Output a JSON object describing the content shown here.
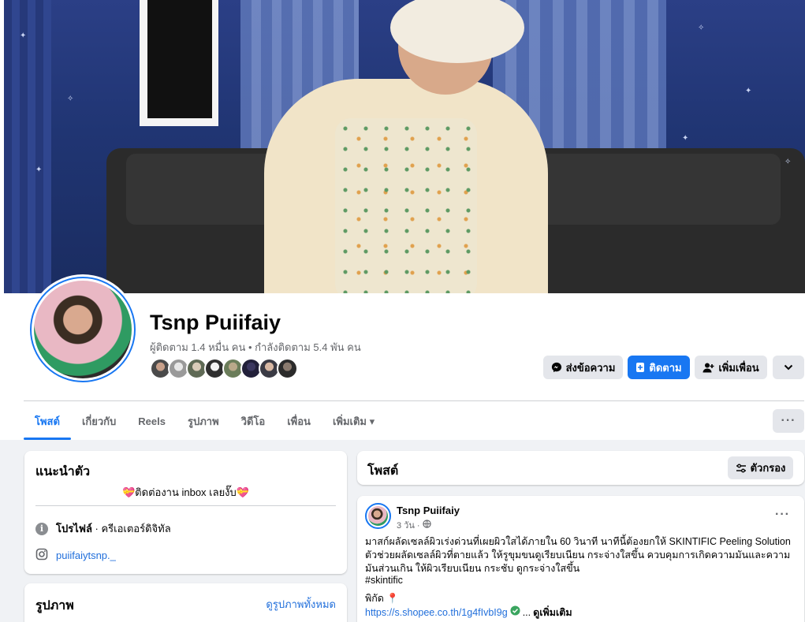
{
  "colors": {
    "accent": "#1877f2",
    "link": "#216fdb",
    "muted": "#65676b",
    "bg": "#f0f2f5"
  },
  "profile": {
    "name": "Tsnp Puiifaiy",
    "followers_line": "ผู้ติดตาม 1.4 หมื่น คน • กำลังติดตาม 5.4 พัน คน",
    "friend_avatars_count": 8
  },
  "actions": {
    "message": {
      "label": "ส่งข้อความ",
      "icon": "messenger-icon"
    },
    "follow": {
      "label": "ติดตาม",
      "icon": "follow-icon"
    },
    "add_friend": {
      "label": "เพิ่มเพื่อน",
      "icon": "add-friend-icon"
    },
    "more": {
      "icon": "chevron-down-icon"
    }
  },
  "tabs": [
    {
      "label": "โพสต์",
      "active": true
    },
    {
      "label": "เกี่ยวกับ",
      "active": false
    },
    {
      "label": "Reels",
      "active": false
    },
    {
      "label": "รูปภาพ",
      "active": false
    },
    {
      "label": "วิดีโอ",
      "active": false
    },
    {
      "label": "เพื่อน",
      "active": false
    },
    {
      "label": "เพิ่มเติม ▾",
      "active": false
    }
  ],
  "intro": {
    "title": "แนะนำตัว",
    "bio": "💝ติดต่องาน inbox เลยงั๊บ💝",
    "profile_label": "โปรไฟล์",
    "profile_category": " · ครีเอเตอร์ดิจิทัล",
    "instagram": "puiifaiytsnp._"
  },
  "photos": {
    "title": "รูปภาพ",
    "see_all": "ดูรูปภาพทั้งหมด"
  },
  "posts_header": {
    "title": "โพสต์",
    "filter_label": "ตัวกรอง"
  },
  "post": {
    "author": "Tsnp Puiifaiy",
    "time": "3 วัน ·",
    "text": "มาสก์ผลัดเซลล์ผิวเร่งด่วนที่เผยผิวใสได้ภายใน 60 วินาที นาทีนี้ต้องยกให้ SKINTIFIC Peeling Solution ตัวช่วยผลัดเซลล์ผิวที่ตายแล้ว ให้รูขุมขนดูเรียบเนียน กระจ่างใสขึ้น ควบคุมการเกิดความมันและความมันส่วนเกิน ให้ผิวเรียบเนียน กระชับ ดูกระจ่างใสขึ้น",
    "hashtag": "#skintific",
    "pin_label": "พิกัด 📍",
    "link": "https://s.shopee.co.th/1g4fIvbI9g",
    "ellipsis": "...",
    "see_more": "ดูเพิ่มเติม"
  }
}
